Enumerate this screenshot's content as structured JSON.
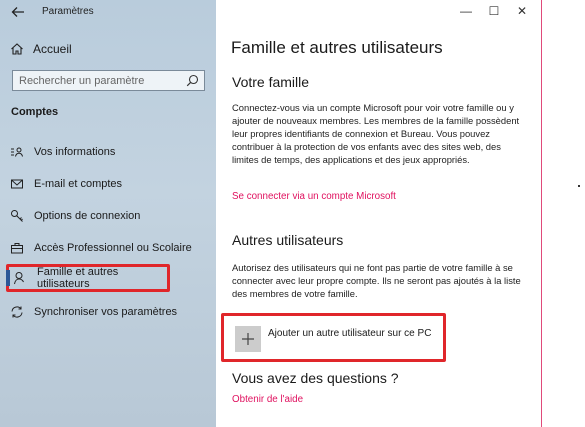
{
  "app": {
    "title": "Paramètres"
  },
  "sidebar": {
    "home_label": "Accueil",
    "search_placeholder": "Rechercher un paramètre",
    "section_title": "Comptes",
    "items": [
      {
        "label": "Vos informations",
        "icon": "person-card-icon"
      },
      {
        "label": "E-mail et comptes",
        "icon": "mail-icon"
      },
      {
        "label": "Options de connexion",
        "icon": "key-icon"
      },
      {
        "label": "Accès Professionnel ou Scolaire",
        "icon": "briefcase-icon"
      },
      {
        "label": "Famille et autres utilisateurs",
        "icon": "person-icon",
        "active": true
      },
      {
        "label": "Synchroniser vos paramètres",
        "icon": "sync-icon"
      }
    ]
  },
  "window_controls": {
    "minimize": "—",
    "maximize": "☐",
    "close": "✕"
  },
  "main": {
    "title": "Famille et autres utilisateurs",
    "family": {
      "heading": "Votre famille",
      "text": "Connectez-vous via un compte Microsoft pour voir votre famille ou y ajouter de nouveaux membres. Les membres de la famille possèdent leur propres identifiants de connexion et Bureau. Vous pouvez contribuer à la protection de vos enfants avec des sites web, des limites de temps, des applications et des jeux appropriés.",
      "link": "Se connecter via un compte Microsoft"
    },
    "others": {
      "heading": "Autres utilisateurs",
      "text": "Autorisez des utilisateurs qui ne font pas partie de votre famille à se connecter avec leur propre compte. Ils ne seront pas ajoutés à la liste des membres de votre famille.",
      "add_label": "Ajouter un autre utilisateur sur ce PC"
    },
    "questions": {
      "heading": "Vous avez des questions ?",
      "link": "Obtenir de l'aide"
    }
  },
  "colors": {
    "accent_link": "#e0115f",
    "highlight": "#e0262a",
    "sidebar": "#bccede"
  }
}
